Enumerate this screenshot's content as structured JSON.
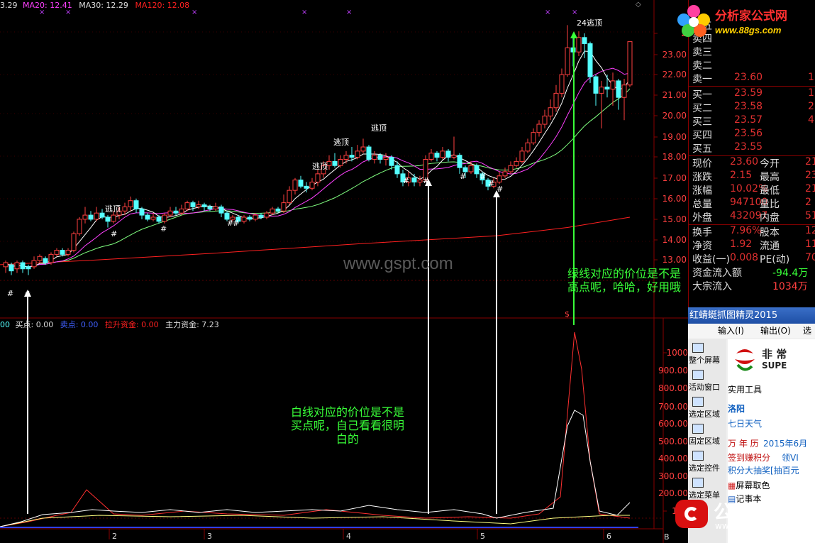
{
  "colors": {
    "up": "#ff4040",
    "down": "#54ffff",
    "ma_white": "#ffffff",
    "ma_magenta": "#ff40ff",
    "ma_green": "#80ff80",
    "ma_red": "#ff2020",
    "annotation_green": "#39ff39",
    "annotation_white": "#ffffff",
    "border": "#880000"
  },
  "legend_top": {
    "ma_partial": "3.29",
    "ma20": "MA20: 12.41",
    "ma30": "MA30: 12.29",
    "ma120": "MA120: 12.08",
    "corner_icon": "diamond-icon"
  },
  "legend_bottom": {
    "prefix": "00",
    "buy": "买点: 0.00",
    "sell": "卖点: 0.00",
    "lift": "拉升资金: 0.00",
    "main": "主力资金: 7.23"
  },
  "price_axis": [
    "2",
    "23.00",
    "22.00",
    "21.00",
    "20.00",
    "19.00",
    "18.00",
    "17.00",
    "16.00",
    "15.00",
    "14.00",
    "13.00"
  ],
  "volume_axis": [
    "1000",
    "900.00",
    "800.00",
    "700.00",
    "600.00",
    "500.00",
    "400.00",
    "300.00",
    "200.00",
    "100"
  ],
  "date_labels": [
    "2",
    "3",
    "4",
    "5",
    "6"
  ],
  "axis_corner": "B",
  "markers": {
    "escape_top": "逃顶",
    "escape_top_24": "24逃顶",
    "hash": "#",
    "dollar": "$"
  },
  "watermark": "www.gspt.com",
  "annotation_green": {
    "line1": "绿线对应的价位是不是",
    "line2": "高点呢，哈哈，好用哦"
  },
  "annotation_white": {
    "line1": "白线对应的价位是不是",
    "line2": "买点呢，自己看看很明",
    "line3": "白的"
  },
  "logo": {
    "title": "分析家公式网",
    "url": "www.88gs.com"
  },
  "quote": {
    "sell": [
      {
        "label": "卖五",
        "price": "",
        "vol": ""
      },
      {
        "label": "卖四",
        "price": "",
        "vol": ""
      },
      {
        "label": "卖三",
        "price": "",
        "vol": ""
      },
      {
        "label": "卖二",
        "price": "",
        "vol": ""
      },
      {
        "label": "卖一",
        "price": "23.60",
        "vol": "1"
      }
    ],
    "buy": [
      {
        "label": "买一",
        "price": "23.59",
        "vol": "1"
      },
      {
        "label": "买二",
        "price": "23.58",
        "vol": "2"
      },
      {
        "label": "买三",
        "price": "23.57",
        "vol": "4"
      },
      {
        "label": "买四",
        "price": "23.56",
        "vol": ""
      },
      {
        "label": "买五",
        "price": "23.55",
        "vol": ""
      }
    ],
    "stats": [
      {
        "l1": "现价",
        "v1": "23.60",
        "l2": "今开",
        "v2": "21"
      },
      {
        "l1": "涨跌",
        "v1": "2.15",
        "l2": "最高",
        "v2": "23"
      },
      {
        "l1": "涨幅",
        "v1": "10.02%",
        "l2": "最低",
        "v2": "21"
      },
      {
        "l1": "总量",
        "v1": "947100",
        "l2": "量比",
        "v2": "2"
      },
      {
        "l1": "外盘",
        "v1": "432097",
        "l2": "内盘",
        "v2": "5150"
      }
    ],
    "stats2": [
      {
        "l1": "换手",
        "v1": "7.96%",
        "l2": "股本",
        "v2": "12.7"
      },
      {
        "l1": "净资",
        "v1": "1.92",
        "l2": "流通",
        "v2": "11.9"
      },
      {
        "l1": "收益(一)",
        "v1": "0.008",
        "l2": "PE(动)",
        "v2": "70"
      }
    ],
    "flow": [
      {
        "label": "资金流入额",
        "value": "-94.4万"
      },
      {
        "label": "大宗流入",
        "value": "1034万"
      }
    ]
  },
  "snip_window": {
    "title": "红蜻蜓抓图精灵2015",
    "menu": [
      "输入(I)",
      "输出(O)",
      "选项"
    ],
    "side": [
      "整个屏幕",
      "活动窗口",
      "选定区域",
      "固定区域",
      "选定控件",
      "选定菜单"
    ],
    "brand": "非 常",
    "brand_sub": "SUPE",
    "tools_heading": "实用工具",
    "city": "洛阳",
    "weather": "七日天气",
    "calendar": "万 年 历",
    "calendar_date": "2015年6月",
    "points1": "签到赚积分",
    "points1b": "领VI",
    "points2": "积分大抽奖[抽百元",
    "screen_color": "屏幕取色",
    "notepad": "记事本"
  },
  "gspt": {
    "title": "公式平台",
    "url": "www.gspt.com"
  }
}
